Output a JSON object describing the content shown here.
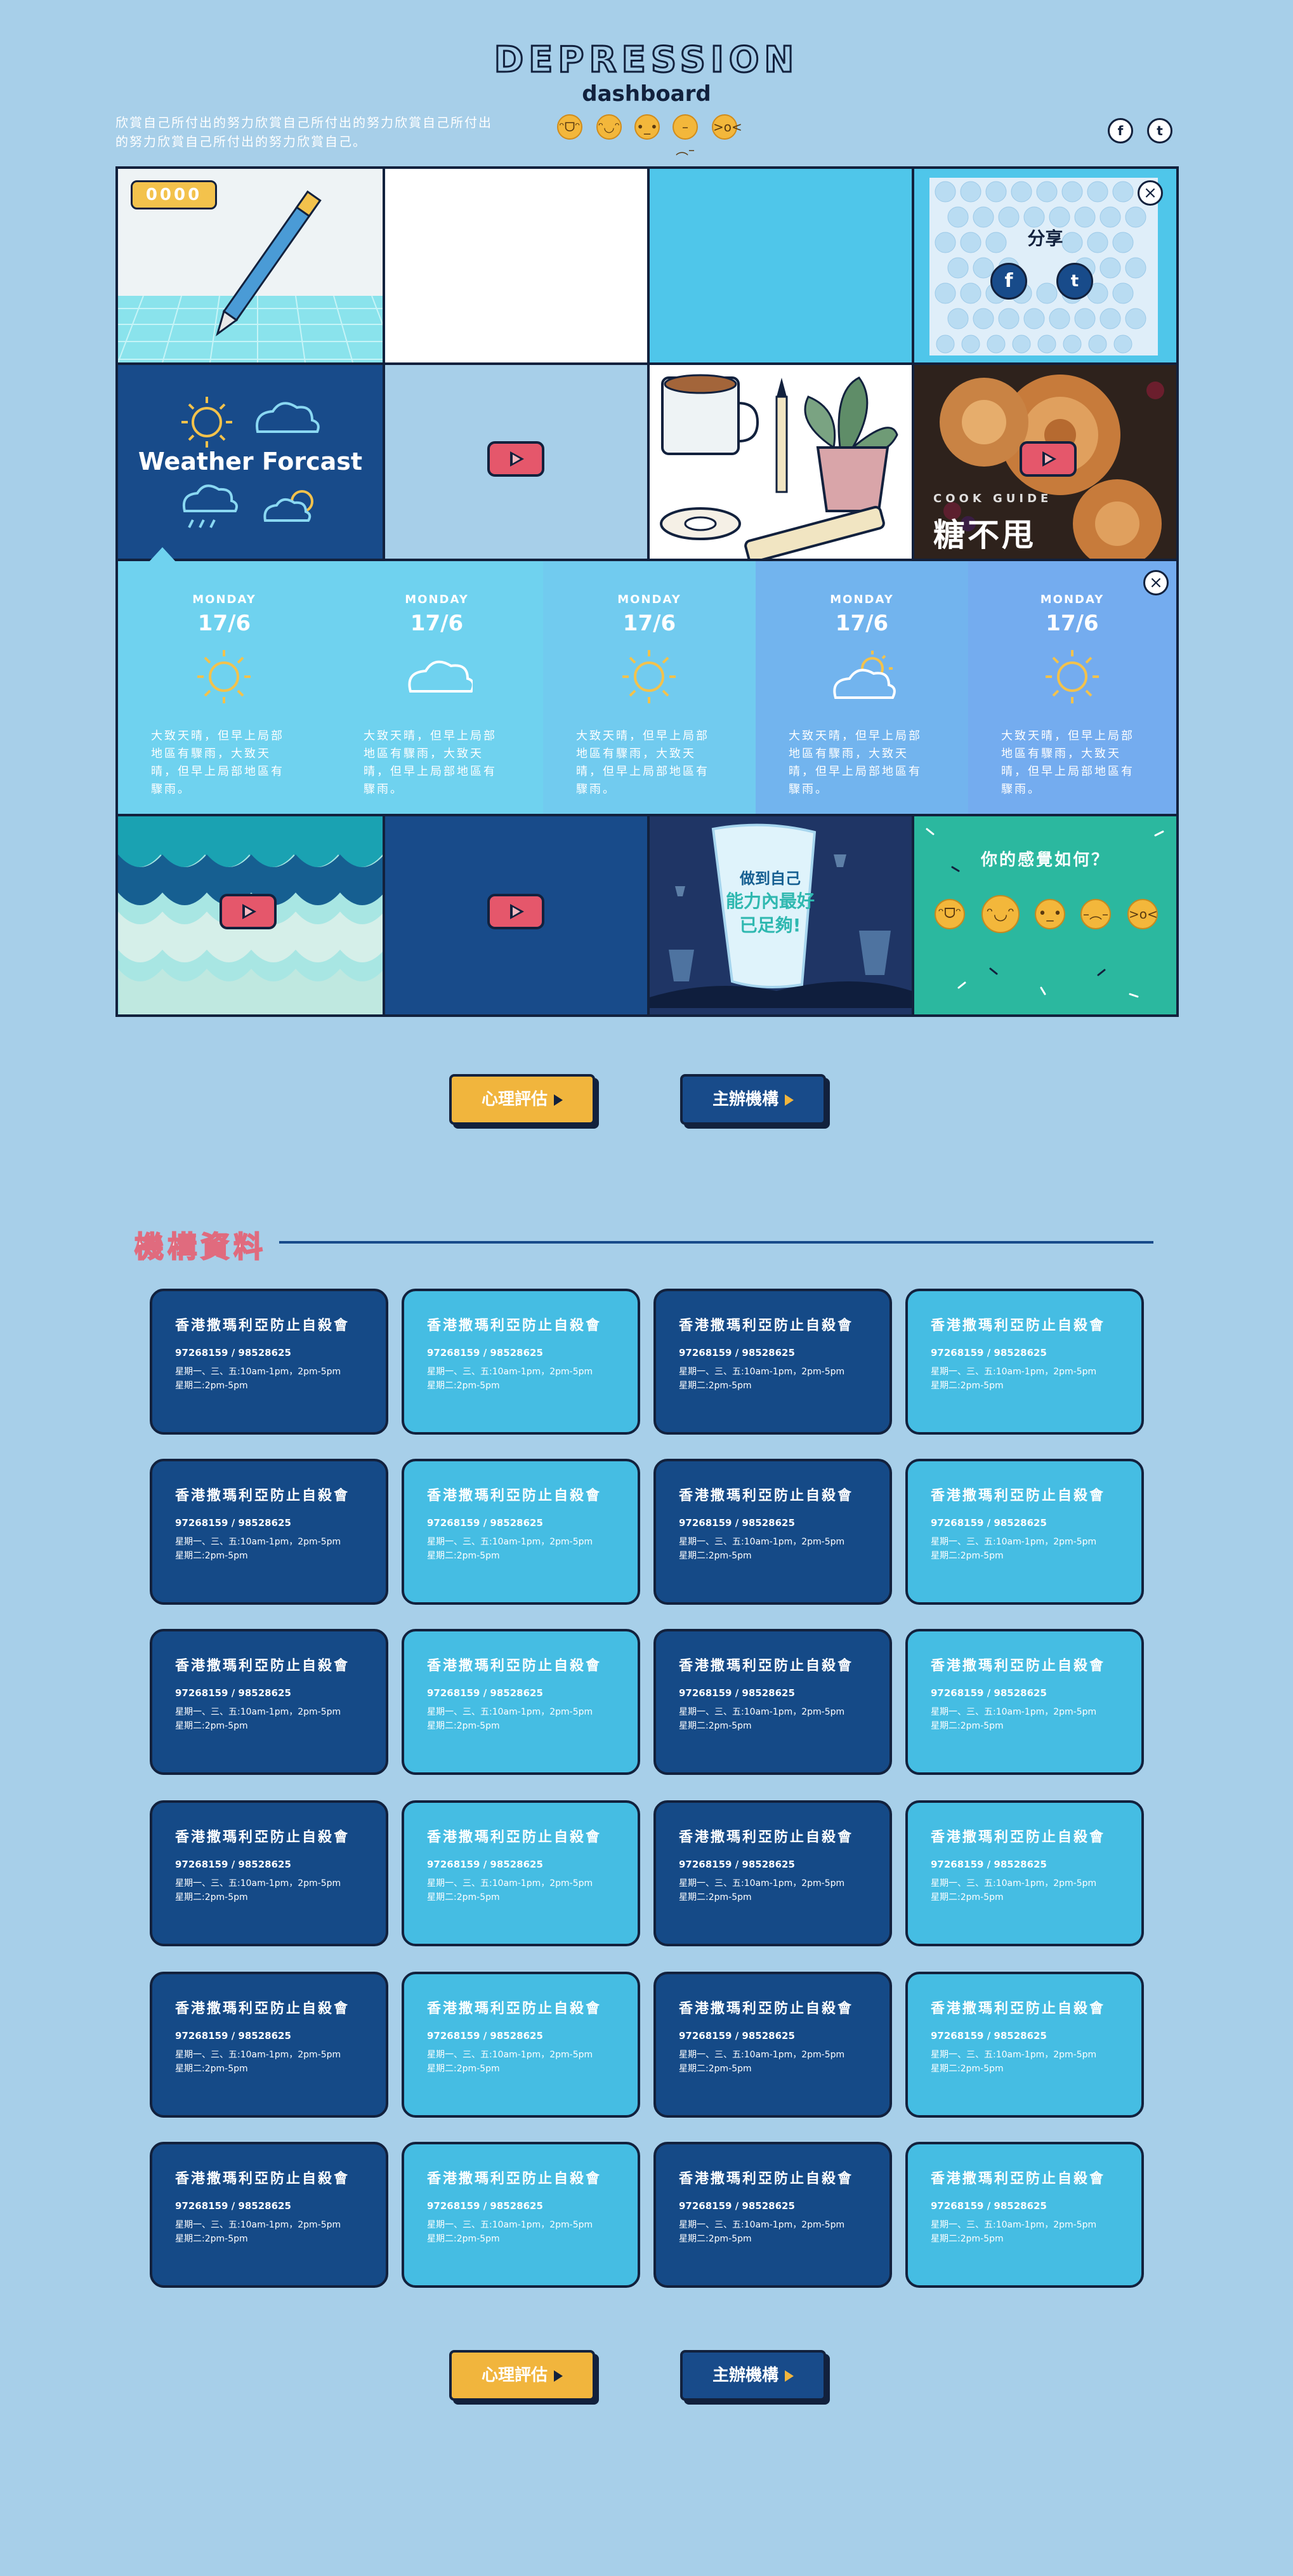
{
  "header": {
    "title": "DEPRESSION",
    "subtitle": "dashboard",
    "intro": "欣賞自己所付出的努力欣賞自己所付出的努力欣賞自己所付出的努力欣賞自己所付出的努力欣賞自己。"
  },
  "header_moods": [
    "laugh-face-icon",
    "grin-face-icon",
    "neutral-face-icon",
    "sad-face-icon",
    "tired-face-icon"
  ],
  "social": [
    "facebook-icon",
    "twitter-icon"
  ],
  "grid": {
    "counter": "0000",
    "share_label": "分享",
    "weather_title": "Weather Forcast",
    "cook_guide_label": "COOK GUIDE",
    "cook_guide_title": "糖不甩",
    "lantern_line1": "做到自己",
    "lantern_line2": "能力內最好",
    "lantern_line3": "已足夠!",
    "feeling_question": "你的感覺如何？"
  },
  "forecast": [
    {
      "day": "MONDAY",
      "date": "17/6",
      "icon": "sun-icon",
      "desc": "大致天晴，但早上局部地區有驟雨，大致天晴，但早上局部地區有驟雨。",
      "bg": "#6fd2ef"
    },
    {
      "day": "MONDAY",
      "date": "17/6",
      "icon": "cloud-icon",
      "desc": "大致天晴，但早上局部地區有驟雨，大致天晴，但早上局部地區有驟雨。",
      "bg": "#6fd2ef"
    },
    {
      "day": "MONDAY",
      "date": "17/6",
      "icon": "sun-icon",
      "desc": "大致天晴，但早上局部地區有驟雨，大致天晴，但早上局部地區有驟雨。",
      "bg": "#71cbef"
    },
    {
      "day": "MONDAY",
      "date": "17/6",
      "icon": "sun-cloud-icon",
      "desc": "大致天晴，但早上局部地區有驟雨，大致天晴，但早上局部地區有驟雨。",
      "bg": "#72b4ee"
    },
    {
      "day": "MONDAY",
      "date": "17/6",
      "icon": "sun-icon",
      "desc": "大致天晴，但早上局部地區有驟雨，大致天晴，但早上局部地區有驟雨。",
      "bg": "#74acef"
    }
  ],
  "buttons": {
    "assessment": "心理評估",
    "organizers": "主辦機構"
  },
  "org_section": {
    "title": "機構資料",
    "cards": [
      {
        "name": "香港撒瑪利亞防止自殺會",
        "phone": "97268159 / 98528625",
        "hours1": "星期一、三、五:10am-1pm，2pm-5pm",
        "hours2": "星期二:2pm-5pm"
      }
    ]
  },
  "colors": {
    "background": "#a7cfe9",
    "dark_blue": "#154a87",
    "light_blue": "#45bde3",
    "yellow": "#f1b53d",
    "pink": "#e5576b"
  }
}
